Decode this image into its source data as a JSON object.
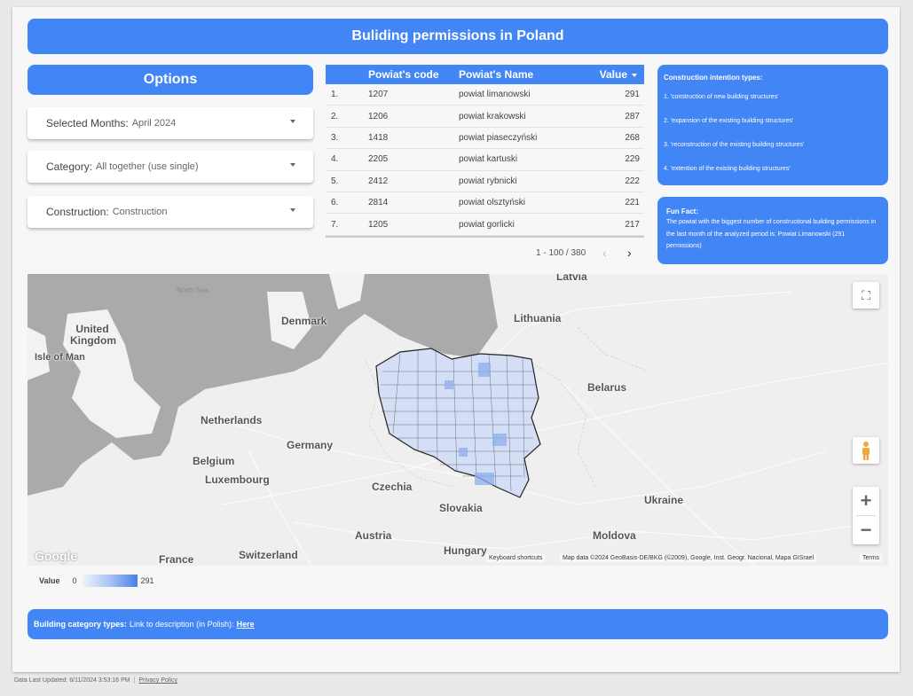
{
  "header": {
    "title": "Buliding permissions in Poland"
  },
  "options": {
    "title": "Options",
    "dropdowns": [
      {
        "label": "Selected Months:",
        "value": "April 2024"
      },
      {
        "label": "Category:",
        "value": "All together (use single)"
      },
      {
        "label": "Construction:",
        "value": "Construction"
      }
    ]
  },
  "table": {
    "columns": {
      "code": "Powiat's code",
      "name": "Powiat's Name",
      "value": "Value"
    },
    "rows": [
      {
        "idx": "1.",
        "code": "1207",
        "name": "powiat limanowski",
        "value": "291"
      },
      {
        "idx": "2.",
        "code": "1206",
        "name": "powiat krakowski",
        "value": "287"
      },
      {
        "idx": "3.",
        "code": "1418",
        "name": "powiat piaseczyński",
        "value": "268"
      },
      {
        "idx": "4.",
        "code": "2205",
        "name": "powiat kartuski",
        "value": "229"
      },
      {
        "idx": "5.",
        "code": "2412",
        "name": "powiat rybnicki",
        "value": "222"
      },
      {
        "idx": "6.",
        "code": "2814",
        "name": "powiat olsztyński",
        "value": "221"
      },
      {
        "idx": "7.",
        "code": "1205",
        "name": "powiat gorlicki",
        "value": "217"
      }
    ],
    "pagination": "1 - 100 / 380"
  },
  "intent": {
    "title": "Construction intention types:",
    "items": [
      "1.  'construction of new building structures'",
      "2.  'expansion of the existing building structures'",
      "3. 'reconstruction of the existing building structures'",
      "4. 'extention of the existing building structures'"
    ]
  },
  "fun_fact": {
    "title": "Fun Fact:",
    "text": "The powiat with the biggest number of constructional building permissions in the last month of the analyzed period is: Powiat Limanowski (291 permissions)"
  },
  "map": {
    "labels": {
      "north_sea": "North Sea",
      "latvia": "Latvia",
      "united_kingdom": "United Kingdom",
      "isle_of_man": "Isle of Man",
      "denmark": "Denmark",
      "lithuania": "Lithuania",
      "belarus": "Belarus",
      "netherlands": "Netherlands",
      "germany": "Germany",
      "belgium": "Belgium",
      "luxembourg": "Luxembourg",
      "czechia": "Czechia",
      "slovakia": "Slovakia",
      "ukraine": "Ukraine",
      "austria": "Austria",
      "hungary": "Hungary",
      "moldova": "Moldova",
      "france": "France",
      "switzerland": "Switzerland"
    },
    "google": "Google",
    "keyboard_shortcuts": "Keyboard shortcuts",
    "map_data": "Map data ©2024 GeoBasis-DE/BKG (©2009), Google, Inst. Geogr. Nacional, Mapa GISrael",
    "terms": "Terms",
    "zoom_in": "+",
    "zoom_out": "−"
  },
  "legend": {
    "label": "Value",
    "min": "0",
    "max": "291"
  },
  "bottom_bar": {
    "label": "Building category types:",
    "text": "Link to description (in Polish):",
    "link": "Here"
  },
  "footer": {
    "last_updated": "Data Last Updated: 6/11/2024 3:53:16 PM",
    "privacy": "Privacy Policy"
  },
  "colors": {
    "accent": "#4285f4",
    "canvas": "#f7f7f7",
    "water": "#aaaaaa"
  }
}
